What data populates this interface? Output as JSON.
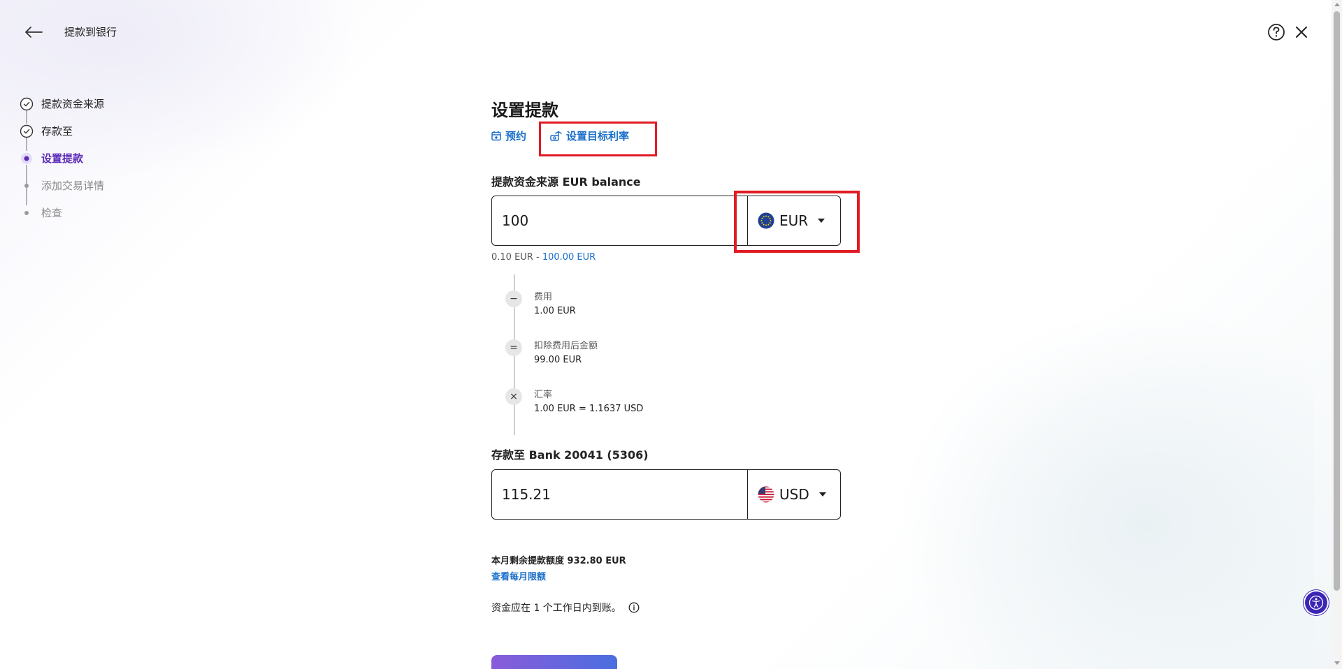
{
  "header": {
    "title": "提款到银行"
  },
  "stepper": {
    "steps": [
      {
        "label": "提款资金来源",
        "state": "done"
      },
      {
        "label": "存款至",
        "state": "done"
      },
      {
        "label": "设置提款",
        "state": "active"
      },
      {
        "label": "添加交易详情",
        "state": "pending"
      },
      {
        "label": "检查",
        "state": "pending"
      }
    ]
  },
  "main": {
    "title": "设置提款",
    "schedule_link": "预约",
    "target_rate_link": "设置目标利率",
    "source_label": "提款资金来源 EUR balance",
    "source_amount": "100",
    "source_currency": "EUR",
    "range_min": "0.10 EUR",
    "range_sep": " - ",
    "range_max": "100.00 EUR",
    "breakdown": {
      "fee_icon": "−",
      "fee_label": "费用",
      "fee_value": "1.00 EUR",
      "net_icon": "=",
      "net_label": "扣除费用后金额",
      "net_value": "99.00 EUR",
      "rate_icon": "×",
      "rate_label": "汇率",
      "rate_value": "1.00 EUR = 1.1637 USD"
    },
    "deposit_label": "存款至 Bank 20041 (5306)",
    "deposit_amount": "115.21",
    "deposit_currency": "USD",
    "monthly_limit_text": "本月剩余提款额度 932.80 EUR",
    "monthly_limit_link": "查看每月限额",
    "arrival_text": "资金应在 1 个工作日内到账。"
  },
  "colors": {
    "accent_link": "#1a6fc9",
    "active_step": "#5b2bb8",
    "highlight_red": "#e01b24"
  }
}
